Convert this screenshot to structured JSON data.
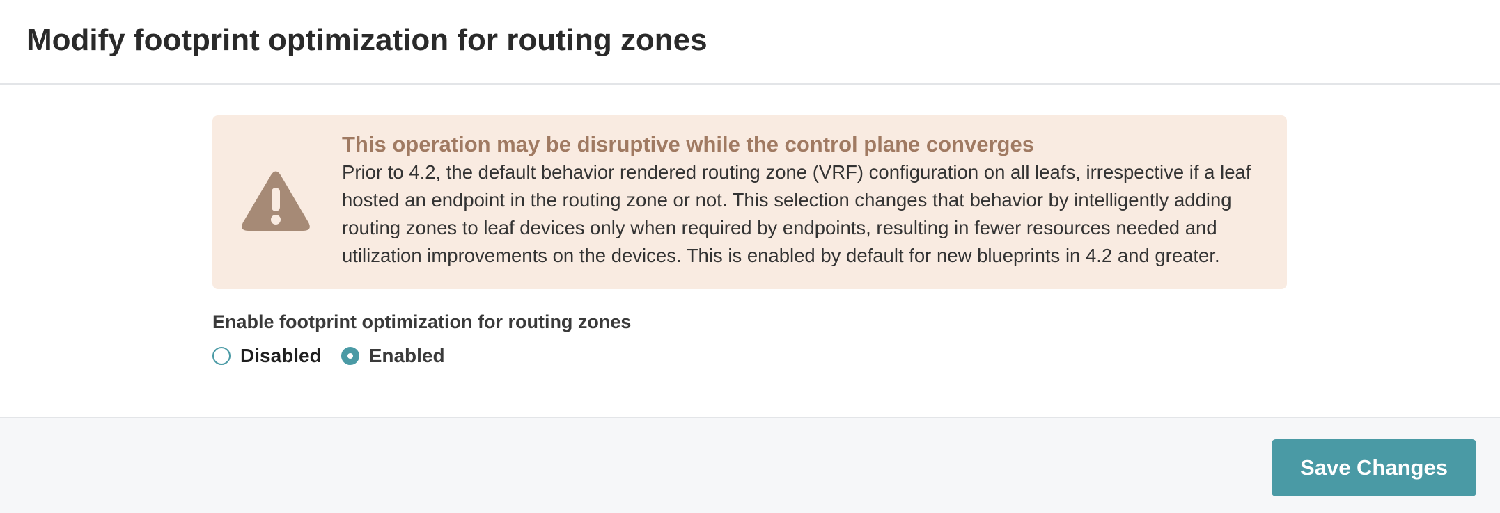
{
  "modal": {
    "title": "Modify footprint optimization for routing zones"
  },
  "alert": {
    "icon": "warning-triangle-icon",
    "icon_color": "#a68a76",
    "background": "#f9ebe1",
    "title": "This operation may be disruptive while the control plane converges",
    "title_color": "#a07a62",
    "body": "Prior to 4.2, the default behavior rendered routing zone (VRF) configuration on all leafs, irrespective if a leaf hosted an endpoint in the routing zone or not. This selection changes that behavior by intelligently adding routing zones to leaf devices only when required by endpoints, resulting in fewer resources needed and utilization improvements on the devices. This is enabled by default for new blueprints in 4.2 and greater."
  },
  "form": {
    "label": "Enable footprint optimization for routing zones",
    "options": [
      {
        "label": "Disabled",
        "checked": false
      },
      {
        "label": "Enabled",
        "checked": true
      }
    ],
    "selected": "Enabled"
  },
  "footer": {
    "save_label": "Save Changes"
  },
  "colors": {
    "accent": "#4a9aa5",
    "footer_bg": "#f6f7f9",
    "divider": "#e3e5e8"
  }
}
